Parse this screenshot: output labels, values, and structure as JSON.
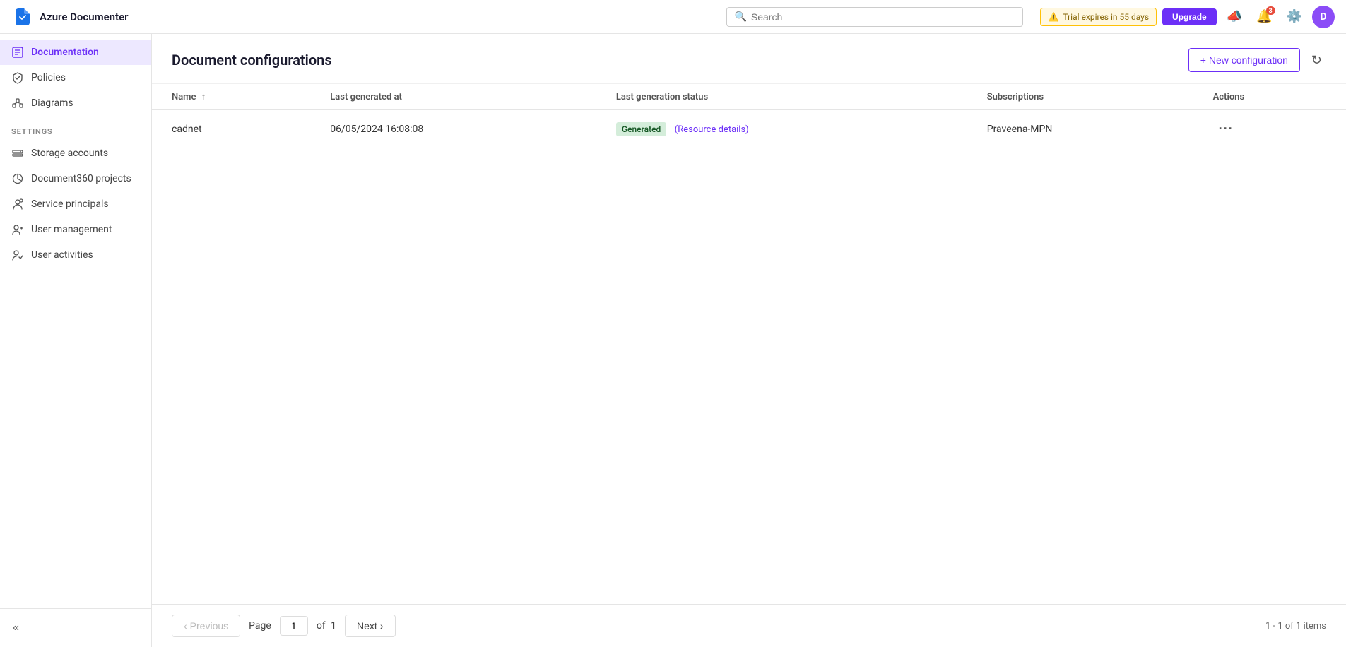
{
  "app": {
    "name": "Azure Documenter",
    "brand_icon_color": "#1a73e8"
  },
  "topnav": {
    "search_placeholder": "Search",
    "trial_text": "Trial expires in 55 days",
    "upgrade_label": "Upgrade",
    "notification_count": "3",
    "avatar_letter": "D"
  },
  "sidebar": {
    "nav_items": [
      {
        "id": "documentation",
        "label": "Documentation",
        "active": true
      },
      {
        "id": "policies",
        "label": "Policies",
        "active": false
      },
      {
        "id": "diagrams",
        "label": "Diagrams",
        "active": false
      }
    ],
    "settings_label": "SETTINGS",
    "settings_items": [
      {
        "id": "storage-accounts",
        "label": "Storage accounts"
      },
      {
        "id": "document360-projects",
        "label": "Document360 projects"
      },
      {
        "id": "service-principals",
        "label": "Service principals"
      },
      {
        "id": "user-management",
        "label": "User management"
      },
      {
        "id": "user-activities",
        "label": "User activities"
      }
    ],
    "collapse_title": "Collapse sidebar"
  },
  "main": {
    "page_title": "Document configurations",
    "new_config_label": "+ New configuration",
    "table": {
      "columns": [
        {
          "id": "name",
          "label": "Name",
          "sortable": true
        },
        {
          "id": "last_generated_at",
          "label": "Last generated at"
        },
        {
          "id": "last_generation_status",
          "label": "Last generation status"
        },
        {
          "id": "subscriptions",
          "label": "Subscriptions"
        },
        {
          "id": "actions",
          "label": "Actions"
        }
      ],
      "rows": [
        {
          "name": "cadnet",
          "last_generated_at": "06/05/2024 16:08:08",
          "status_badge": "Generated",
          "resource_details_label": "(Resource details)",
          "subscription": "Praveena-MPN",
          "actions_label": "···"
        }
      ]
    },
    "pagination": {
      "previous_label": "Previous",
      "page_label": "Page",
      "page_value": "1",
      "of_label": "of",
      "total_pages": "1",
      "next_label": "Next",
      "items_summary": "1 - 1 of 1 items"
    }
  }
}
